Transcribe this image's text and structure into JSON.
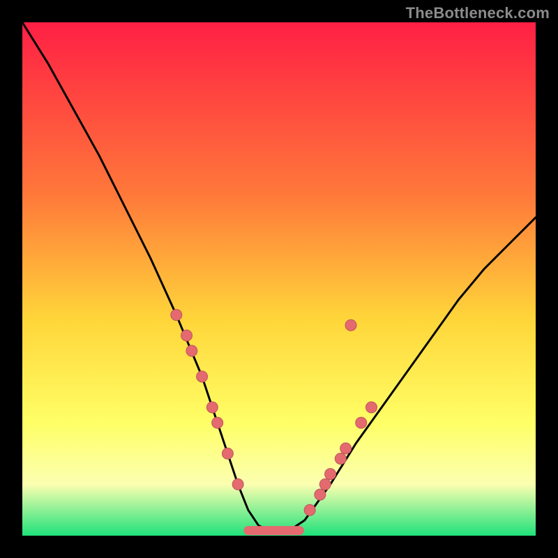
{
  "watermark": "TheBottleneck.com",
  "colors": {
    "gradient_top": "#ff1f44",
    "gradient_mid1": "#ff7a3a",
    "gradient_mid2": "#ffd63a",
    "gradient_mid3": "#ffff66",
    "gradient_mid4": "#fbffb0",
    "gradient_bottom": "#1fe17a",
    "curve": "#000000",
    "points": "#e46a6f",
    "frame": "#000000"
  },
  "chart_data": {
    "type": "line",
    "title": "",
    "xlabel": "",
    "ylabel": "",
    "xlim": [
      0,
      100
    ],
    "ylim": [
      0,
      100
    ],
    "grid": false,
    "legend": false,
    "annotations": [],
    "series": [
      {
        "name": "bottleneck-curve",
        "x": [
          0,
          5,
          10,
          15,
          20,
          25,
          30,
          35,
          40,
          42,
          44,
          46,
          48,
          50,
          52,
          55,
          60,
          65,
          70,
          75,
          80,
          85,
          90,
          95,
          100
        ],
        "y": [
          100,
          92,
          83,
          74,
          64,
          54,
          43,
          31,
          16,
          10,
          5,
          2,
          1,
          1,
          1,
          3,
          10,
          18,
          25,
          32,
          39,
          46,
          52,
          57,
          62
        ]
      }
    ],
    "marker_cluster": {
      "name": "data-points",
      "points": [
        {
          "x": 30,
          "y": 43
        },
        {
          "x": 32,
          "y": 39
        },
        {
          "x": 33,
          "y": 36
        },
        {
          "x": 35,
          "y": 31
        },
        {
          "x": 37,
          "y": 25
        },
        {
          "x": 38,
          "y": 22
        },
        {
          "x": 40,
          "y": 16
        },
        {
          "x": 42,
          "y": 10
        },
        {
          "x": 56,
          "y": 5
        },
        {
          "x": 58,
          "y": 8
        },
        {
          "x": 59,
          "y": 10
        },
        {
          "x": 60,
          "y": 12
        },
        {
          "x": 62,
          "y": 15
        },
        {
          "x": 63,
          "y": 17
        },
        {
          "x": 66,
          "y": 22
        },
        {
          "x": 68,
          "y": 25
        },
        {
          "x": 64,
          "y": 41
        }
      ]
    },
    "flat_bottom": {
      "x_start": 44,
      "x_end": 54,
      "y": 1
    }
  }
}
